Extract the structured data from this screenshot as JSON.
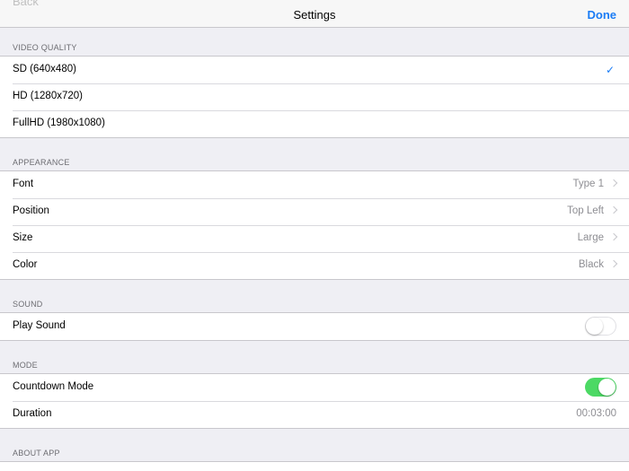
{
  "navbar": {
    "back": "Back",
    "title": "Settings",
    "done": "Done"
  },
  "video_quality": {
    "header": "VIDEO QUALITY",
    "options": [
      "SD (640x480)",
      "HD (1280x720)",
      "FullHD (1980x1080)"
    ],
    "selected": "SD (640x480)",
    "checkmark": "✓"
  },
  "appearance": {
    "header": "APPEARANCE",
    "rows": [
      {
        "label": "Font",
        "value": "Type 1"
      },
      {
        "label": "Position",
        "value": "Top Left"
      },
      {
        "label": "Size",
        "value": "Large"
      },
      {
        "label": "Color",
        "value": "Black"
      }
    ]
  },
  "sound": {
    "header": "SOUND",
    "play_sound_label": "Play Sound",
    "play_sound_on": false
  },
  "mode": {
    "header": "MODE",
    "countdown_label": "Countdown Mode",
    "countdown_on": true,
    "duration_label": "Duration",
    "duration_value": "00:03:00"
  },
  "about": {
    "header": "ABOUT APP"
  },
  "colors": {
    "accent": "#1a7cf5",
    "toggle_on": "#4cd964",
    "background": "#efeff4"
  }
}
